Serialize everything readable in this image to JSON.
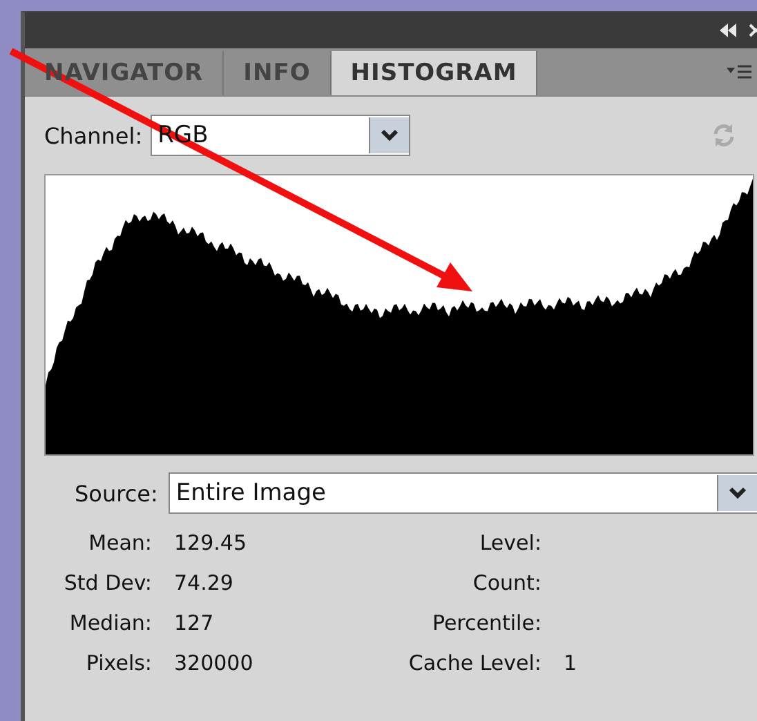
{
  "panel": {
    "tabs": [
      {
        "label": "NAVIGATOR",
        "selected": false
      },
      {
        "label": "INFO",
        "selected": false
      },
      {
        "label": "HISTOGRAM",
        "selected": true
      }
    ],
    "channel": {
      "label": "Channel:",
      "value": "RGB"
    },
    "source": {
      "label": "Source:",
      "value": "Entire Image"
    },
    "stats_left": [
      {
        "label": "Mean:",
        "value": "129.45"
      },
      {
        "label": "Std Dev:",
        "value": "74.29"
      },
      {
        "label": "Median:",
        "value": "127"
      },
      {
        "label": "Pixels:",
        "value": "320000"
      }
    ],
    "stats_right": [
      {
        "label": "Level:"
      },
      {
        "label": "Count:"
      },
      {
        "label": "Percentile:"
      },
      {
        "label": "Cache Level:",
        "value": "1"
      }
    ]
  }
}
